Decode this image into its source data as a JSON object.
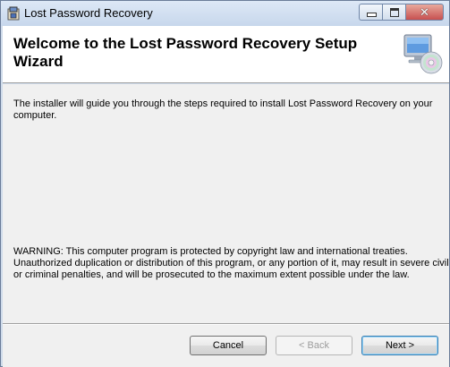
{
  "window": {
    "title": "Lost Password Recovery",
    "icons": {
      "app": "installer-icon",
      "header": "computer-cd-icon"
    }
  },
  "header": {
    "title": "Welcome to the Lost Password Recovery Setup Wizard"
  },
  "content": {
    "intro": "The installer will guide you through the steps required to install Lost Password Recovery on your computer.",
    "warning_lines": [
      "WARNING: This computer program is protected by copyright law and international treaties.",
      "Unauthorized duplication or distribution of this program, or any portion of it, may result in severe civil",
      "or criminal penalties, and will be prosecuted to the maximum extent possible under the law."
    ]
  },
  "buttons": {
    "cancel": "Cancel",
    "back": "< Back",
    "next": "Next >"
  },
  "colors": {
    "titlebar": "#c7d7ec",
    "header_bg": "#ffffff",
    "body_bg": "#f0f0f0",
    "default_button_border": "#3c7fb1"
  }
}
